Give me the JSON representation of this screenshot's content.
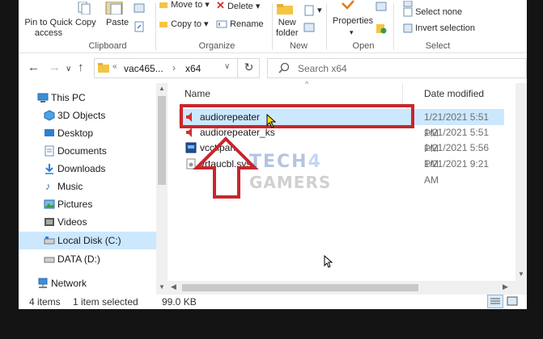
{
  "ribbon": {
    "pin_label_1": "Pin to Quick",
    "pin_label_2": "access",
    "copy_label": "Copy",
    "paste_label": "Paste",
    "move_to_label": "Move to",
    "copy_to_label": "Copy to",
    "delete_label": "Delete",
    "rename_label": "Rename",
    "new_folder_label_1": "New",
    "new_folder_label_2": "folder",
    "properties_label": "Properties",
    "select_none_label": "Select none",
    "invert_selection_label": "Invert selection",
    "groups": {
      "clipboard": "Clipboard",
      "organize": "Organize",
      "new": "New",
      "open": "Open",
      "select": "Select"
    }
  },
  "address": {
    "crumb_1": "vac465...",
    "separator": "›",
    "crumb_2": "x64",
    "search_placeholder": "Search x64"
  },
  "nav": {
    "items": [
      {
        "label": "This PC",
        "icon": "computer-icon"
      },
      {
        "label": "3D Objects",
        "icon": "cube-icon"
      },
      {
        "label": "Desktop",
        "icon": "desktop-icon"
      },
      {
        "label": "Documents",
        "icon": "documents-icon"
      },
      {
        "label": "Downloads",
        "icon": "download-icon"
      },
      {
        "label": "Music",
        "icon": "music-icon"
      },
      {
        "label": "Pictures",
        "icon": "pictures-icon"
      },
      {
        "label": "Videos",
        "icon": "videos-icon"
      },
      {
        "label": "Local Disk (C:)",
        "icon": "drive-icon"
      },
      {
        "label": "DATA (D:)",
        "icon": "drive-icon"
      },
      {
        "label": "Network",
        "icon": "network-icon"
      }
    ]
  },
  "files": {
    "columns": {
      "name": "Name",
      "date": "Date modified"
    },
    "rows": [
      {
        "name": "audiorepeater",
        "date": "1/21/2021 5:51 PM",
        "icon": "speaker-app-icon"
      },
      {
        "name": "audiorepeater_ks",
        "date": "1/21/2021 5:51 PM",
        "icon": "speaker-app-icon"
      },
      {
        "name": "vcctlpan",
        "date": "1/21/2021 5:56 PM",
        "icon": "control-panel-icon"
      },
      {
        "name": "vrtaucbl.sys",
        "date": "1/21/2021 9:21 AM",
        "icon": "system-file-icon"
      }
    ]
  },
  "status": {
    "items_count": "4 items",
    "selection": "1 item selected",
    "size": "99.0 KB"
  },
  "watermark": {
    "line1": "TECH",
    "line1_digit": "4",
    "line2": "GAMERS"
  },
  "colors": {
    "selection": "#cce8ff",
    "highlight_red": "#c8262c",
    "folder_yellow": "#f5c542"
  }
}
